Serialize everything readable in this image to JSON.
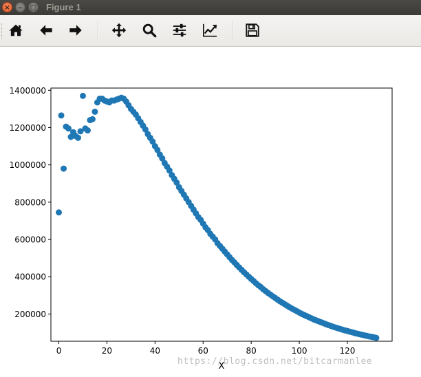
{
  "window": {
    "title": "Figure 1",
    "close_glyph": "×",
    "minimize_glyph": "–",
    "maximize_glyph": "□"
  },
  "toolbar": {
    "buttons": [
      {
        "name": "home-button",
        "icon": "home-icon"
      },
      {
        "name": "back-button",
        "icon": "arrow-left-icon"
      },
      {
        "name": "forward-button",
        "icon": "arrow-right-icon"
      },
      {
        "name": "pan-button",
        "icon": "move-icon"
      },
      {
        "name": "zoom-button",
        "icon": "magnifier-icon"
      },
      {
        "name": "subplots-button",
        "icon": "sliders-icon"
      },
      {
        "name": "edit-axes-button",
        "icon": "line-chart-icon"
      },
      {
        "name": "save-button",
        "icon": "floppy-disk-icon"
      }
    ]
  },
  "chart_data": {
    "type": "scatter",
    "xlabel": "X",
    "ylabel": "",
    "title": "",
    "xlim": [
      -3.3,
      138.6
    ],
    "ylim": [
      54000,
      1412000
    ],
    "xticks": [
      0,
      20,
      40,
      60,
      80,
      100,
      120
    ],
    "yticks": [
      200000,
      400000,
      600000,
      800000,
      1000000,
      1200000,
      1400000
    ],
    "xtick_labels": [
      "0",
      "20",
      "40",
      "60",
      "80",
      "100",
      "120"
    ],
    "ytick_labels": [
      "200000",
      "400000",
      "600000",
      "800000",
      "1000000",
      "1200000",
      "1400000"
    ],
    "marker_color": "#1f77b4",
    "grid": false,
    "x": [
      0,
      1,
      2,
      3,
      4,
      5,
      6,
      7,
      8,
      9,
      10,
      11,
      12,
      13,
      14,
      15,
      16,
      17,
      18,
      19,
      20,
      21,
      22,
      23,
      24,
      25,
      26,
      27,
      28,
      29,
      30,
      31,
      32,
      33,
      34,
      35,
      36,
      37,
      38,
      39,
      40,
      41,
      42,
      43,
      44,
      45,
      46,
      47,
      48,
      49,
      50,
      51,
      52,
      53,
      54,
      55,
      56,
      57,
      58,
      59,
      60,
      61,
      62,
      63,
      64,
      65,
      66,
      67,
      68,
      69,
      70,
      71,
      72,
      73,
      74,
      75,
      76,
      77,
      78,
      79,
      80,
      81,
      82,
      83,
      84,
      85,
      86,
      87,
      88,
      89,
      90,
      91,
      92,
      93,
      94,
      95,
      96,
      97,
      98,
      99,
      100,
      101,
      102,
      103,
      104,
      105,
      106,
      107,
      108,
      109,
      110,
      111,
      112,
      113,
      114,
      115,
      116,
      117,
      118,
      119,
      120,
      121,
      122,
      123,
      124,
      125,
      126,
      127,
      128,
      129,
      130,
      131,
      132
    ],
    "y": [
      745000,
      1265000,
      980000,
      1205000,
      1195000,
      1150000,
      1175000,
      1155000,
      1145000,
      1180000,
      1370000,
      1195000,
      1185000,
      1240000,
      1245000,
      1285000,
      1335000,
      1355000,
      1355000,
      1345000,
      1340000,
      1335000,
      1345000,
      1345000,
      1350000,
      1355000,
      1360000,
      1355000,
      1340000,
      1320000,
      1300000,
      1285000,
      1270000,
      1250000,
      1230000,
      1210000,
      1190000,
      1165000,
      1145000,
      1125000,
      1100000,
      1080000,
      1055000,
      1035000,
      1010000,
      990000,
      970000,
      945000,
      925000,
      905000,
      880000,
      860000,
      840000,
      820000,
      800000,
      780000,
      760000,
      740000,
      720000,
      705000,
      685000,
      665000,
      650000,
      630000,
      615000,
      600000,
      580000,
      565000,
      550000,
      535000,
      520000,
      505000,
      490000,
      477000,
      463000,
      450000,
      437000,
      424000,
      412000,
      400000,
      388000,
      377000,
      365000,
      354000,
      344000,
      333000,
      323000,
      313000,
      304000,
      295000,
      286000,
      277000,
      268000,
      260000,
      252000,
      244000,
      236000,
      229000,
      222000,
      215000,
      208000,
      201000,
      195000,
      189000,
      183000,
      177000,
      171000,
      166000,
      161000,
      156000,
      151000,
      146000,
      141000,
      137000,
      132000,
      128000,
      124000,
      120000,
      116000,
      112000,
      109000,
      105000,
      102000,
      98000,
      95000,
      92000,
      89000,
      86000,
      83000,
      80000,
      78000,
      75000,
      72000
    ]
  },
  "watermark": "https://blog.csdn.net/bitcarmanlee"
}
